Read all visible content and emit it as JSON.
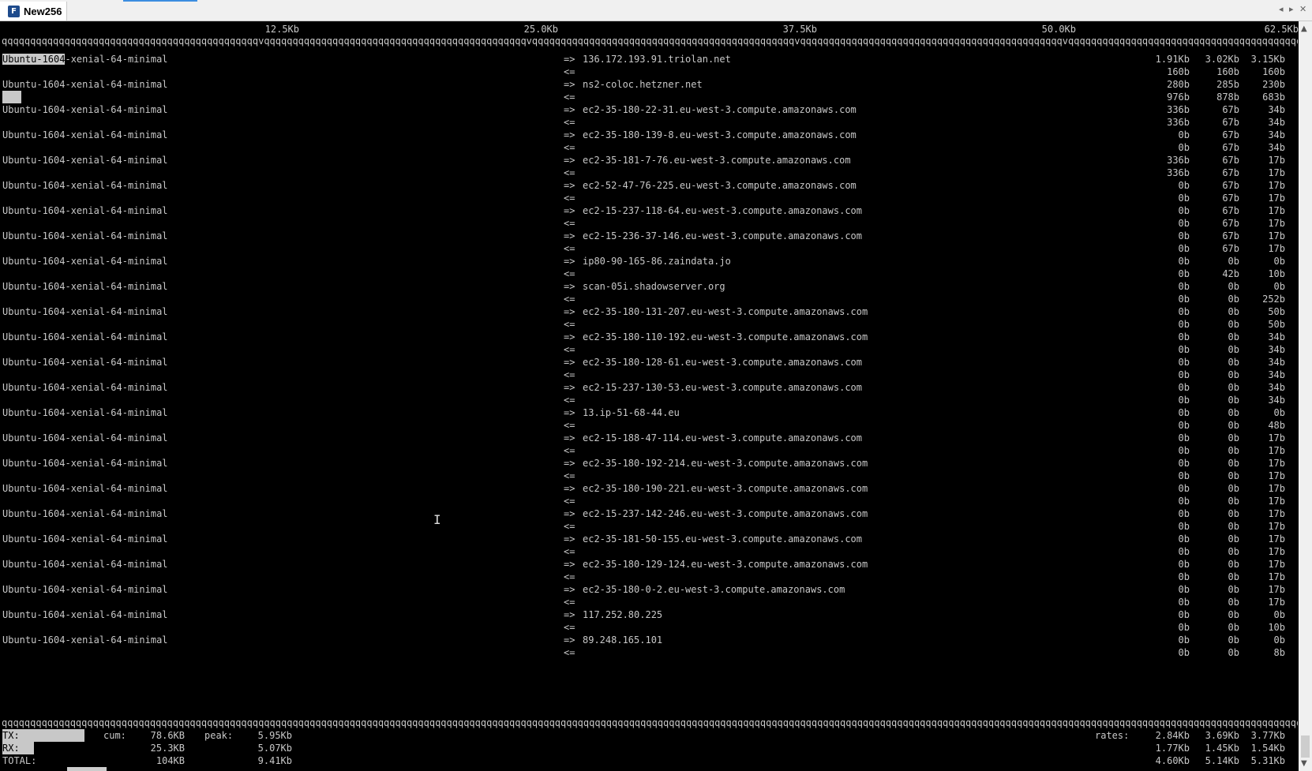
{
  "window": {
    "tab_title": "New256",
    "app_icon_glyph": "F"
  },
  "scale": [
    "12.5Kb",
    "25.0Kb",
    "37.5Kb",
    "50.0Kb",
    "62.5Kb"
  ],
  "rule_char": "q",
  "rule_tick_char": "v",
  "rows": [
    {
      "src": "Ubuntu-1604-xenial-64-minimal",
      "dst": "136.172.193.91.triolan.net",
      "tx": [
        "1.91Kb",
        "3.02Kb",
        "3.15Kb"
      ],
      "rx": [
        "160b",
        "160b",
        "160b"
      ]
    },
    {
      "src": "Ubuntu-1604-xenial-64-minimal",
      "dst": "ns2-coloc.hetzner.net",
      "tx": [
        "280b",
        "285b",
        "230b"
      ],
      "rx": [
        "976b",
        "878b",
        "683b"
      ]
    },
    {
      "src": "Ubuntu-1604-xenial-64-minimal",
      "dst": "ec2-35-180-22-31.eu-west-3.compute.amazonaws.com",
      "tx": [
        "336b",
        "67b",
        "34b"
      ],
      "rx": [
        "336b",
        "67b",
        "34b"
      ]
    },
    {
      "src": "Ubuntu-1604-xenial-64-minimal",
      "dst": "ec2-35-180-139-8.eu-west-3.compute.amazonaws.com",
      "tx": [
        "0b",
        "67b",
        "34b"
      ],
      "rx": [
        "0b",
        "67b",
        "34b"
      ]
    },
    {
      "src": "Ubuntu-1604-xenial-64-minimal",
      "dst": "ec2-35-181-7-76.eu-west-3.compute.amazonaws.com",
      "tx": [
        "336b",
        "67b",
        "17b"
      ],
      "rx": [
        "336b",
        "67b",
        "17b"
      ]
    },
    {
      "src": "Ubuntu-1604-xenial-64-minimal",
      "dst": "ec2-52-47-76-225.eu-west-3.compute.amazonaws.com",
      "tx": [
        "0b",
        "67b",
        "17b"
      ],
      "rx": [
        "0b",
        "67b",
        "17b"
      ]
    },
    {
      "src": "Ubuntu-1604-xenial-64-minimal",
      "dst": "ec2-15-237-118-64.eu-west-3.compute.amazonaws.com",
      "tx": [
        "0b",
        "67b",
        "17b"
      ],
      "rx": [
        "0b",
        "67b",
        "17b"
      ]
    },
    {
      "src": "Ubuntu-1604-xenial-64-minimal",
      "dst": "ec2-15-236-37-146.eu-west-3.compute.amazonaws.com",
      "tx": [
        "0b",
        "67b",
        "17b"
      ],
      "rx": [
        "0b",
        "67b",
        "17b"
      ]
    },
    {
      "src": "Ubuntu-1604-xenial-64-minimal",
      "dst": "ip80-90-165-86.zaindata.jo",
      "tx": [
        "0b",
        "0b",
        "0b"
      ],
      "rx": [
        "0b",
        "42b",
        "10b"
      ]
    },
    {
      "src": "Ubuntu-1604-xenial-64-minimal",
      "dst": "scan-05i.shadowserver.org",
      "tx": [
        "0b",
        "0b",
        "0b"
      ],
      "rx": [
        "0b",
        "0b",
        "252b"
      ]
    },
    {
      "src": "Ubuntu-1604-xenial-64-minimal",
      "dst": "ec2-35-180-131-207.eu-west-3.compute.amazonaws.com",
      "tx": [
        "0b",
        "0b",
        "50b"
      ],
      "rx": [
        "0b",
        "0b",
        "50b"
      ]
    },
    {
      "src": "Ubuntu-1604-xenial-64-minimal",
      "dst": "ec2-35-180-110-192.eu-west-3.compute.amazonaws.com",
      "tx": [
        "0b",
        "0b",
        "34b"
      ],
      "rx": [
        "0b",
        "0b",
        "34b"
      ]
    },
    {
      "src": "Ubuntu-1604-xenial-64-minimal",
      "dst": "ec2-35-180-128-61.eu-west-3.compute.amazonaws.com",
      "tx": [
        "0b",
        "0b",
        "34b"
      ],
      "rx": [
        "0b",
        "0b",
        "34b"
      ]
    },
    {
      "src": "Ubuntu-1604-xenial-64-minimal",
      "dst": "ec2-15-237-130-53.eu-west-3.compute.amazonaws.com",
      "tx": [
        "0b",
        "0b",
        "34b"
      ],
      "rx": [
        "0b",
        "0b",
        "34b"
      ]
    },
    {
      "src": "Ubuntu-1604-xenial-64-minimal",
      "dst": "13.ip-51-68-44.eu",
      "tx": [
        "0b",
        "0b",
        "0b"
      ],
      "rx": [
        "0b",
        "0b",
        "48b"
      ]
    },
    {
      "src": "Ubuntu-1604-xenial-64-minimal",
      "dst": "ec2-15-188-47-114.eu-west-3.compute.amazonaws.com",
      "tx": [
        "0b",
        "0b",
        "17b"
      ],
      "rx": [
        "0b",
        "0b",
        "17b"
      ]
    },
    {
      "src": "Ubuntu-1604-xenial-64-minimal",
      "dst": "ec2-35-180-192-214.eu-west-3.compute.amazonaws.com",
      "tx": [
        "0b",
        "0b",
        "17b"
      ],
      "rx": [
        "0b",
        "0b",
        "17b"
      ]
    },
    {
      "src": "Ubuntu-1604-xenial-64-minimal",
      "dst": "ec2-35-180-190-221.eu-west-3.compute.amazonaws.com",
      "tx": [
        "0b",
        "0b",
        "17b"
      ],
      "rx": [
        "0b",
        "0b",
        "17b"
      ]
    },
    {
      "src": "Ubuntu-1604-xenial-64-minimal",
      "dst": "ec2-15-237-142-246.eu-west-3.compute.amazonaws.com",
      "tx": [
        "0b",
        "0b",
        "17b"
      ],
      "rx": [
        "0b",
        "0b",
        "17b"
      ]
    },
    {
      "src": "Ubuntu-1604-xenial-64-minimal",
      "dst": "ec2-35-181-50-155.eu-west-3.compute.amazonaws.com",
      "tx": [
        "0b",
        "0b",
        "17b"
      ],
      "rx": [
        "0b",
        "0b",
        "17b"
      ]
    },
    {
      "src": "Ubuntu-1604-xenial-64-minimal",
      "dst": "ec2-35-180-129-124.eu-west-3.compute.amazonaws.com",
      "tx": [
        "0b",
        "0b",
        "17b"
      ],
      "rx": [
        "0b",
        "0b",
        "17b"
      ]
    },
    {
      "src": "Ubuntu-1604-xenial-64-minimal",
      "dst": "ec2-35-180-0-2.eu-west-3.compute.amazonaws.com",
      "tx": [
        "0b",
        "0b",
        "17b"
      ],
      "rx": [
        "0b",
        "0b",
        "17b"
      ]
    },
    {
      "src": "Ubuntu-1604-xenial-64-minimal",
      "dst": "117.252.80.225",
      "tx": [
        "0b",
        "0b",
        "0b"
      ],
      "rx": [
        "0b",
        "0b",
        "10b"
      ]
    },
    {
      "src": "Ubuntu-1604-xenial-64-minimal",
      "dst": "89.248.165.101",
      "tx": [
        "0b",
        "0b",
        "0b"
      ],
      "rx": [
        "0b",
        "0b",
        "8b"
      ]
    }
  ],
  "arrows": {
    "out": "=>",
    "in": "<="
  },
  "summary": {
    "tx_label": "TX:",
    "rx_label": "RX:",
    "total_label": "TOTAL:",
    "cum_label": "cum:",
    "peak_label": "peak:",
    "rates_label": "rates:",
    "tx": {
      "cum": "78.6KB",
      "peak": "5.95Kb",
      "rates": [
        "2.84Kb",
        "3.69Kb",
        "3.77Kb"
      ]
    },
    "rx": {
      "cum": "25.3KB",
      "peak": "5.07Kb",
      "rates": [
        "1.77Kb",
        "1.45Kb",
        "1.54Kb"
      ]
    },
    "total": {
      "cum": "104KB",
      "peak": "9.41Kb",
      "rates": [
        "4.60Kb",
        "5.14Kb",
        "5.31Kb"
      ]
    }
  }
}
